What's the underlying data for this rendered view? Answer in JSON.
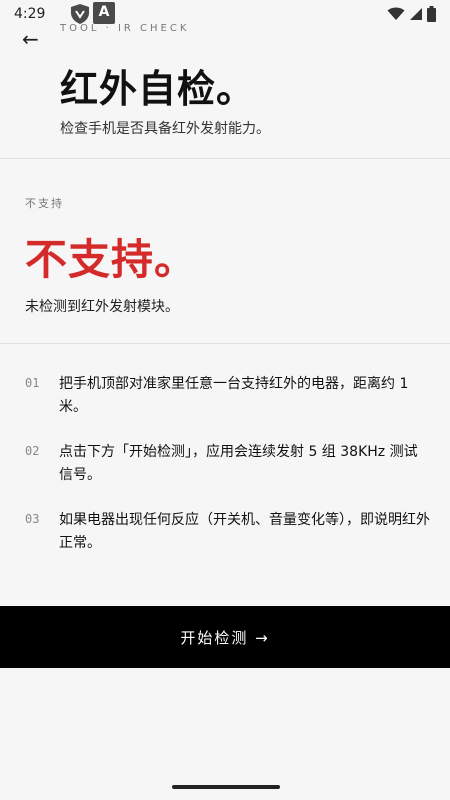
{
  "status_bar": {
    "time": "4:29",
    "overlay_letter": "A",
    "icons": [
      "shield-icon",
      "accessibility-a-icon",
      "wifi-icon",
      "signal-icon",
      "battery-icon"
    ]
  },
  "header": {
    "back_label": "←",
    "breadcrumb": "TOOL · IR CHECK",
    "title": "红外自检。",
    "subtitle": "检查手机是否具备红外发射能力。"
  },
  "result": {
    "label": "不支持",
    "status": "不支持。",
    "description": "未检测到红外发射模块。",
    "status_color": "#d42a2a"
  },
  "steps": [
    {
      "num": "01",
      "text": "把手机顶部对准家里任意一台支持红外的电器，距离约 1 米。"
    },
    {
      "num": "02",
      "text": "点击下方「开始检测」，应用会连续发射 5 组 38KHz 测试信号。"
    },
    {
      "num": "03",
      "text": "如果电器出现任何反应（开关机、音量变化等），即说明红外正常。"
    }
  ],
  "action": {
    "start_label": "开始检测 →"
  }
}
